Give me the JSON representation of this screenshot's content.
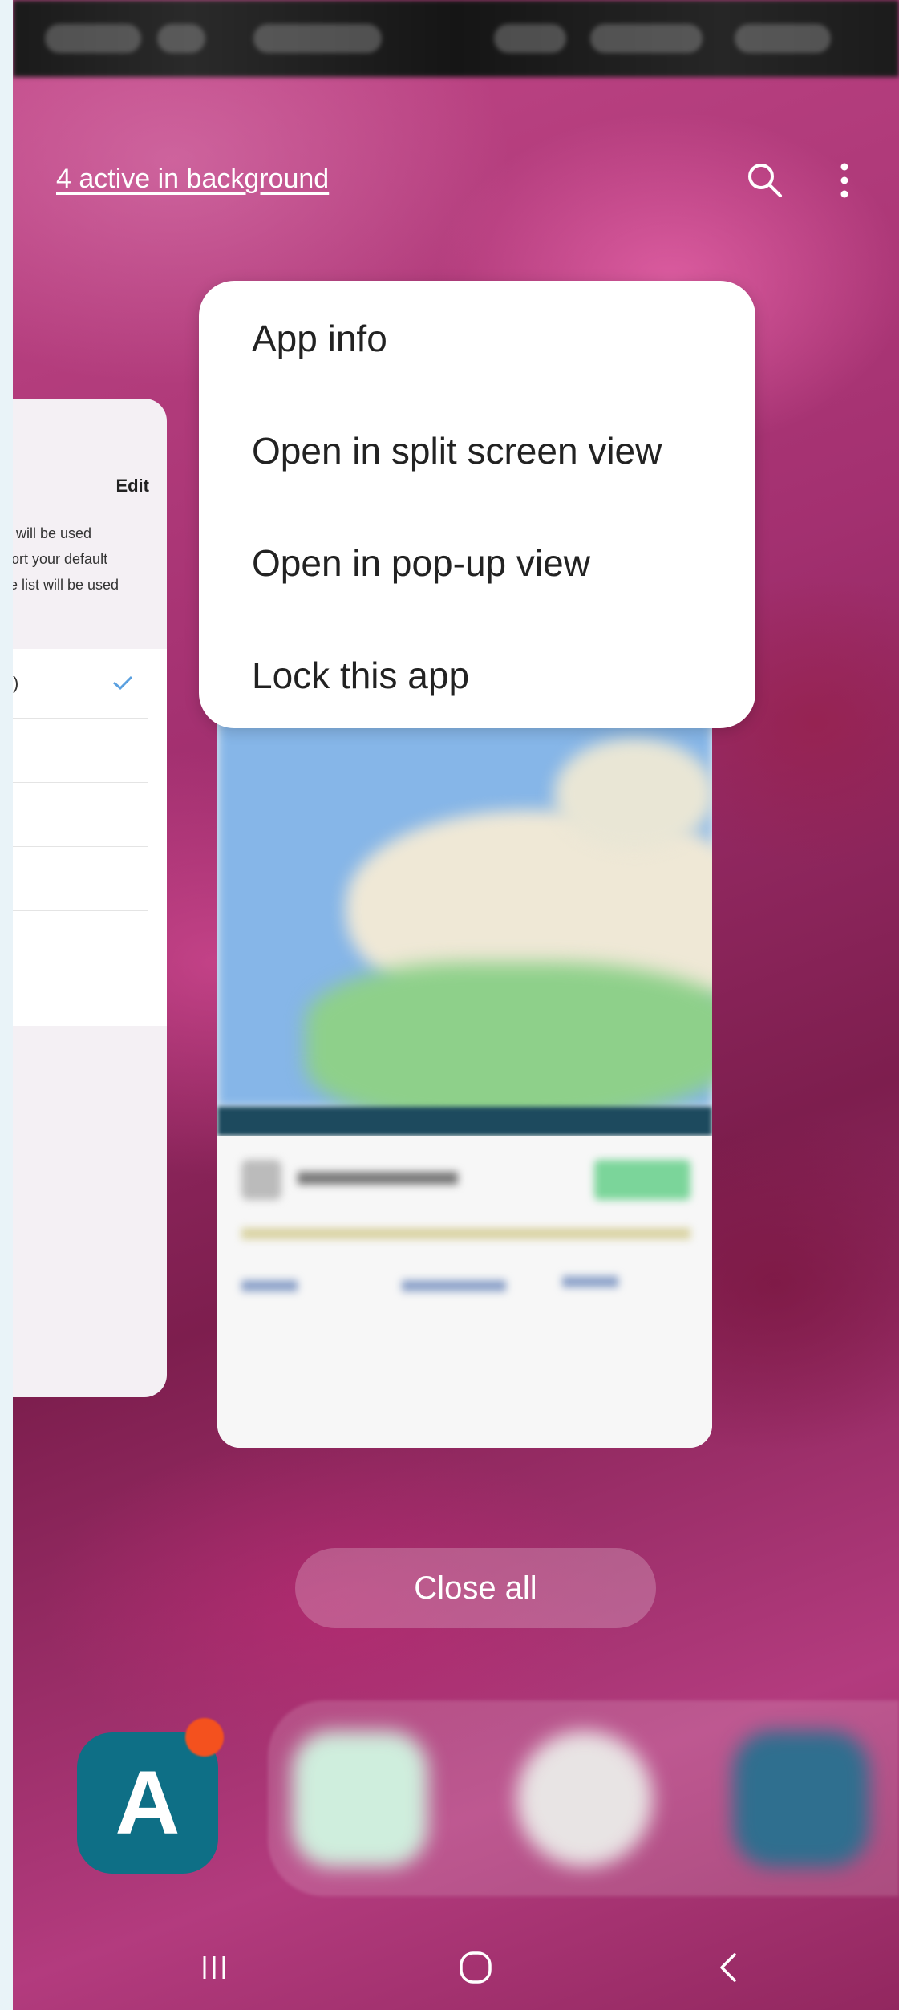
{
  "header": {
    "background_apps_label": "4 active in background"
  },
  "left_card": {
    "edit_label": "Edit",
    "text_line_1": "will be used",
    "text_line_2": "ort your default",
    "text_line_3": "e list will be used",
    "first_row_text": ")"
  },
  "context_menu": {
    "items": [
      {
        "label": "App info"
      },
      {
        "label": "Open in split screen view"
      },
      {
        "label": "Open in pop-up view"
      },
      {
        "label": "Lock this app"
      }
    ]
  },
  "close_all_label": "Close all",
  "dock": {
    "pinned_app_letter": "A"
  },
  "colors": {
    "accent_check": "#5aa0e0",
    "app_tile": "#0e6f86",
    "badge": "#f4511e"
  },
  "icons": [
    "search-icon",
    "more-vertical-icon",
    "check-icon",
    "recents-icon",
    "home-icon",
    "back-icon"
  ]
}
